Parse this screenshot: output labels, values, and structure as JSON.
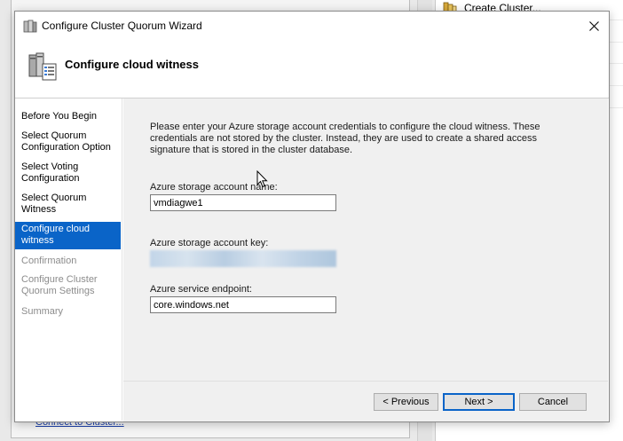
{
  "background": {
    "action_label": "Create Cluster...",
    "bottom_link": "Connect to Cluster..."
  },
  "wizard": {
    "title": "Configure Cluster Quorum Wizard",
    "header_title": "Configure cloud witness",
    "steps": [
      {
        "label": "Before You Begin",
        "state": "done"
      },
      {
        "label": "Select Quorum Configuration Option",
        "state": "done"
      },
      {
        "label": "Select Voting Configuration",
        "state": "done"
      },
      {
        "label": "Select Quorum Witness",
        "state": "done"
      },
      {
        "label": "Configure cloud witness",
        "state": "active"
      },
      {
        "label": "Confirmation",
        "state": "disabled"
      },
      {
        "label": "Configure Cluster Quorum Settings",
        "state": "disabled"
      },
      {
        "label": "Summary",
        "state": "disabled"
      }
    ],
    "description": "Please enter your Azure storage account credentials to configure the cloud witness. These credentials are not stored by the cluster. Instead, they are used to create a shared access signature that is stored in the cluster database.",
    "fields": {
      "account_name_label": "Azure storage account name:",
      "account_name_value": "vmdiagwe1",
      "account_key_label": "Azure storage account key:",
      "endpoint_label": "Azure service endpoint:",
      "endpoint_value": "core.windows.net"
    },
    "buttons": {
      "previous": "< Previous",
      "next": "Next >",
      "cancel": "Cancel"
    }
  },
  "colors": {
    "accent": "#0a64c8",
    "content_bg": "#f0f0f0"
  }
}
